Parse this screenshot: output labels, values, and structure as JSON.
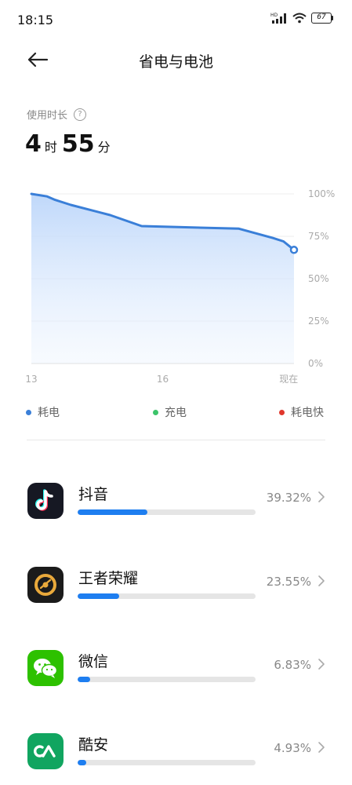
{
  "status_bar": {
    "time": "18:15",
    "network_label": "HD",
    "battery_level": "67"
  },
  "header": {
    "title": "省电与电池"
  },
  "usage": {
    "label": "使用时长",
    "hours": "4",
    "hours_unit": "时",
    "minutes": "55",
    "minutes_unit": "分"
  },
  "chart_data": {
    "type": "area",
    "x_tick_labels": [
      "13",
      "16",
      "现在"
    ],
    "y_tick_labels": [
      "100%",
      "75%",
      "50%",
      "25%",
      "0%"
    ],
    "ylim": [
      0,
      100
    ],
    "series": [
      {
        "name": "耗电",
        "color": "#3a7fd8",
        "points": [
          {
            "x": 0,
            "y": 100
          },
          {
            "x": 0.06,
            "y": 98.5
          },
          {
            "x": 0.09,
            "y": 96.5
          },
          {
            "x": 0.15,
            "y": 93.5
          },
          {
            "x": 0.3,
            "y": 87.5
          },
          {
            "x": 0.42,
            "y": 81
          },
          {
            "x": 0.79,
            "y": 79.5
          },
          {
            "x": 0.92,
            "y": 74
          },
          {
            "x": 0.96,
            "y": 72
          },
          {
            "x": 1.0,
            "y": 67
          }
        ]
      }
    ]
  },
  "legend": [
    {
      "label": "耗电",
      "color": "#3a7fd8"
    },
    {
      "label": "充电",
      "color": "#3cc46a"
    },
    {
      "label": "耗电快",
      "color": "#e0372c"
    }
  ],
  "apps": [
    {
      "name": "抖音",
      "percent_label": "39.32%",
      "percent": 39.32,
      "icon": "douyin-icon"
    },
    {
      "name": "王者荣耀",
      "percent_label": "23.55%",
      "percent": 23.55,
      "icon": "honor-of-kings-icon"
    },
    {
      "name": "微信",
      "percent_label": "6.83%",
      "percent": 6.83,
      "icon": "wechat-icon"
    },
    {
      "name": "酷安",
      "percent_label": "4.93%",
      "percent": 4.93,
      "icon": "coolapk-icon"
    }
  ],
  "colors": {
    "accent": "#1e7ef0",
    "track": "#e5e5e5"
  }
}
